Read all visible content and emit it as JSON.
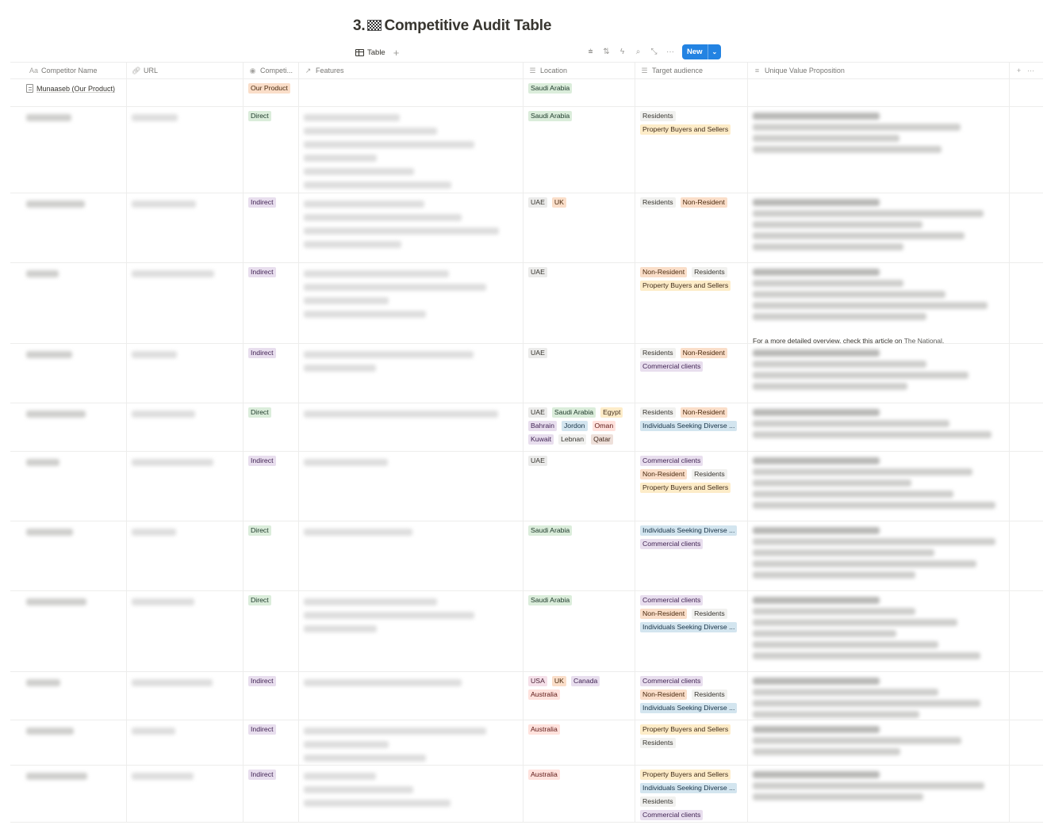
{
  "page": {
    "title_prefix": "3.",
    "title_icon": "checkered-flag-icon",
    "title": "Competitive Audit Table"
  },
  "view": {
    "tab_label": "Table",
    "add_view": "+",
    "tools": [
      "filter-icon",
      "sort-icon",
      "automation-icon",
      "search-icon",
      "expand-icon",
      "more-icon"
    ],
    "new_label": "New",
    "new_dropdown": "⌄"
  },
  "columns": [
    {
      "key": "name",
      "label": "Competitor Name",
      "icon": "Aa"
    },
    {
      "key": "url",
      "label": "URL",
      "icon": "🔗"
    },
    {
      "key": "type",
      "label": "Competi...",
      "icon": "◉"
    },
    {
      "key": "features",
      "label": "Features",
      "icon": "↗"
    },
    {
      "key": "location",
      "label": "Location",
      "icon": "☰"
    },
    {
      "key": "audience",
      "label": "Target audience",
      "icon": "☰"
    },
    {
      "key": "uvp",
      "label": "Unique Value Proposition",
      "icon": "≡"
    }
  ],
  "header_actions": {
    "add": "+",
    "more": "···"
  },
  "tag_colors": {
    "Our Product": "orange",
    "Direct": "green",
    "Indirect": "purple",
    "Saudi Arabia": "green",
    "UAE": "gray",
    "UK": "orange",
    "Egypt": "yellow",
    "Bahrain": "purple",
    "Jordon": "blue",
    "Oman": "red",
    "Kuwait": "purple",
    "Lebnan": "lightgray",
    "Qatar": "brown",
    "USA": "pink",
    "Canada": "purple",
    "Australia": "red",
    "Residents": "lightgray",
    "Non-Resident": "orange",
    "Property Buyers and Sellers": "yellow",
    "Commercial clients": "purple",
    "Individuals Seeking Diverse ...": "blue"
  },
  "rows": [
    {
      "name": "Munaaseb (Our Product)",
      "name_visible": true,
      "url": "",
      "type": "Our Product",
      "features_lines": 0,
      "location": [
        "Saudi Arabia"
      ],
      "audience": [],
      "uvp_lines": 0,
      "uvp_note": null
    },
    {
      "name": "[redacted]",
      "name_visible": false,
      "url": "[redacted]",
      "type": "Direct",
      "features_lines": 6,
      "location": [
        "Saudi Arabia"
      ],
      "audience": [
        "Residents",
        "Property Buyers and Sellers"
      ],
      "uvp_lines": 4,
      "uvp_note": null
    },
    {
      "name": "[redacted]",
      "name_visible": false,
      "url": "[redacted]",
      "type": "Indirect",
      "features_lines": 4,
      "location": [
        "UAE",
        "UK"
      ],
      "audience": [
        "Residents",
        "Non-Resident"
      ],
      "uvp_lines": 5,
      "uvp_note": null
    },
    {
      "name": "[redacted]",
      "name_visible": false,
      "url": "[redacted]",
      "type": "Indirect",
      "features_lines": 4,
      "location": [
        "UAE"
      ],
      "audience": [
        "Non-Resident",
        "Residents",
        "Property Buyers and Sellers"
      ],
      "uvp_lines": 5,
      "uvp_note": {
        "text": "For a more detailed overview, check this article on ",
        "link": "The National",
        "end": "."
      }
    },
    {
      "name": "[redacted]",
      "name_visible": false,
      "url": "[redacted]",
      "type": "Indirect",
      "features_lines": 2,
      "location": [
        "UAE"
      ],
      "audience": [
        "Residents",
        "Non-Resident",
        "Commercial clients"
      ],
      "uvp_lines": 4,
      "uvp_note": null
    },
    {
      "name": "[redacted]",
      "name_visible": false,
      "url": "[redacted]",
      "type": "Direct",
      "features_lines": 1,
      "location": [
        "UAE",
        "Saudi Arabia",
        "Egypt",
        "Bahrain",
        "Jordon",
        "Oman",
        "Kuwait",
        "Lebnan",
        "Qatar"
      ],
      "audience": [
        "Residents",
        "Non-Resident",
        "Individuals Seeking Diverse ..."
      ],
      "uvp_lines": 3,
      "uvp_note": null
    },
    {
      "name": "[redacted]",
      "name_visible": false,
      "url": "[redacted]",
      "type": "Indirect",
      "features_lines": 1,
      "location": [
        "UAE"
      ],
      "audience": [
        "Commercial clients",
        "Non-Resident",
        "Residents",
        "Property Buyers and Sellers"
      ],
      "uvp_lines": 5,
      "uvp_note": null
    },
    {
      "name": "[redacted]",
      "name_visible": false,
      "url": "[redacted]",
      "type": "Direct",
      "features_lines": 1,
      "location": [
        "Saudi Arabia"
      ],
      "audience": [
        "Individuals Seeking Diverse ...",
        "Commercial clients"
      ],
      "uvp_lines": 5,
      "uvp_note": null
    },
    {
      "name": "[redacted]",
      "name_visible": false,
      "url": "[redacted]",
      "type": "Direct",
      "features_lines": 3,
      "location": [
        "Saudi Arabia"
      ],
      "audience": [
        "Commercial clients",
        "Non-Resident",
        "Residents",
        "Individuals Seeking Diverse ..."
      ],
      "uvp_lines": 6,
      "uvp_note": null
    },
    {
      "name": "[redacted]",
      "name_visible": false,
      "url": "[redacted]",
      "type": "Indirect",
      "features_lines": 1,
      "location": [
        "USA",
        "UK",
        "Canada",
        "Australia"
      ],
      "audience": [
        "Commercial clients",
        "Non-Resident",
        "Residents",
        "Individuals Seeking Diverse ..."
      ],
      "uvp_lines": 4,
      "uvp_note": null
    },
    {
      "name": "[redacted]",
      "name_visible": false,
      "url": "[redacted]",
      "type": "Indirect",
      "features_lines": 3,
      "location": [
        "Australia"
      ],
      "audience": [
        "Property Buyers and Sellers",
        "Residents"
      ],
      "uvp_lines": 3,
      "uvp_note": null
    },
    {
      "name": "[redacted]",
      "name_visible": false,
      "url": "[redacted]",
      "type": "Indirect",
      "features_lines": 3,
      "location": [
        "Australia"
      ],
      "audience": [
        "Property Buyers and Sellers",
        "Individuals Seeking Diverse ...",
        "Residents",
        "Commercial clients"
      ],
      "uvp_lines": 3,
      "uvp_note": null
    }
  ]
}
